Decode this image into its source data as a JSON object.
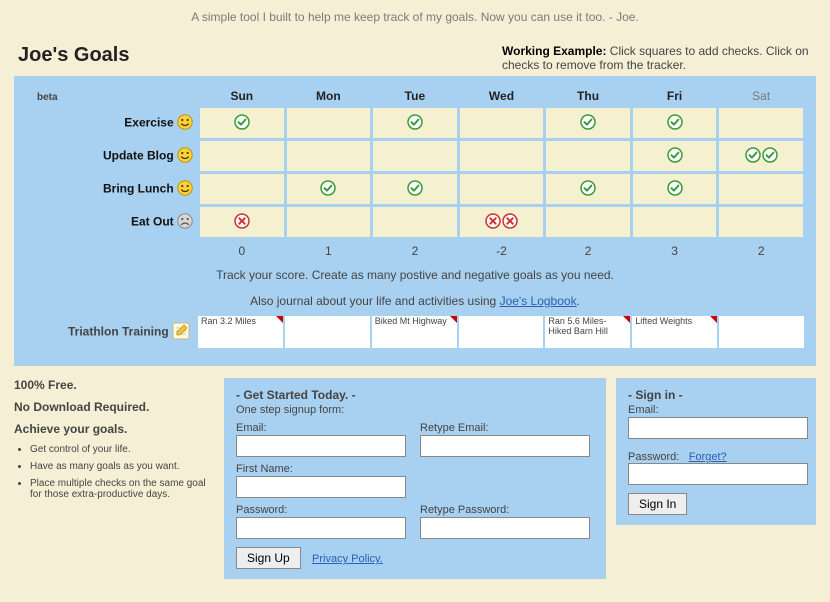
{
  "tagline": "A simple tool I built to help me keep track of my goals. Now you can use it too. - Joe.",
  "title": "Joe's Goals",
  "working_label": "Working Example:",
  "working_text": " Click squares to add checks. Click on checks to remove from the tracker.",
  "beta": "beta",
  "days": [
    "Sun",
    "Mon",
    "Tue",
    "Wed",
    "Thu",
    "Fri",
    "Sat"
  ],
  "goals": [
    {
      "label": "Exercise",
      "positive": true,
      "checks": [
        1,
        0,
        1,
        0,
        1,
        1,
        0
      ]
    },
    {
      "label": "Update Blog",
      "positive": true,
      "checks": [
        0,
        0,
        0,
        0,
        0,
        1,
        2
      ]
    },
    {
      "label": "Bring Lunch",
      "positive": true,
      "checks": [
        0,
        1,
        1,
        0,
        1,
        1,
        0
      ]
    },
    {
      "label": "Eat Out",
      "positive": false,
      "checks": [
        1,
        0,
        0,
        2,
        0,
        0,
        0
      ]
    }
  ],
  "scores": [
    0,
    1,
    2,
    -2,
    2,
    3,
    2
  ],
  "subline1": "Track your score. Create as many postive and negative goals as you need.",
  "subline2_prefix": "Also journal about your life and activities using ",
  "subline2_link": "Joe's Logbook",
  "subline2_suffix": ".",
  "journal_label": "Triathlon Training",
  "journal": [
    "Ran 3.2 Miles",
    "",
    "Biked Mt Highway",
    "",
    "Ran 5.6 Miles- Hiked Barn Hill",
    "Lifted Weights",
    ""
  ],
  "left": {
    "b1": "100% Free.",
    "b2": "No Download Required.",
    "b3": "Achieve your goals.",
    "li1": "Get control of your life.",
    "li2": "Have as many goals as you want.",
    "li3": "Place multiple checks on the same goal for those extra-productive days."
  },
  "signup": {
    "heading": "- Get Started Today. -",
    "sub": "One step signup form:",
    "email": "Email:",
    "retype_email": "Retype Email:",
    "first_name": "First Name:",
    "password": "Password:",
    "retype_password": "Retype Password:",
    "button": "Sign Up",
    "privacy": "Privacy Policy."
  },
  "signin": {
    "heading": "- Sign in -",
    "email": "Email:",
    "password": "Password:",
    "forget": "Forget?",
    "button": "Sign In"
  }
}
